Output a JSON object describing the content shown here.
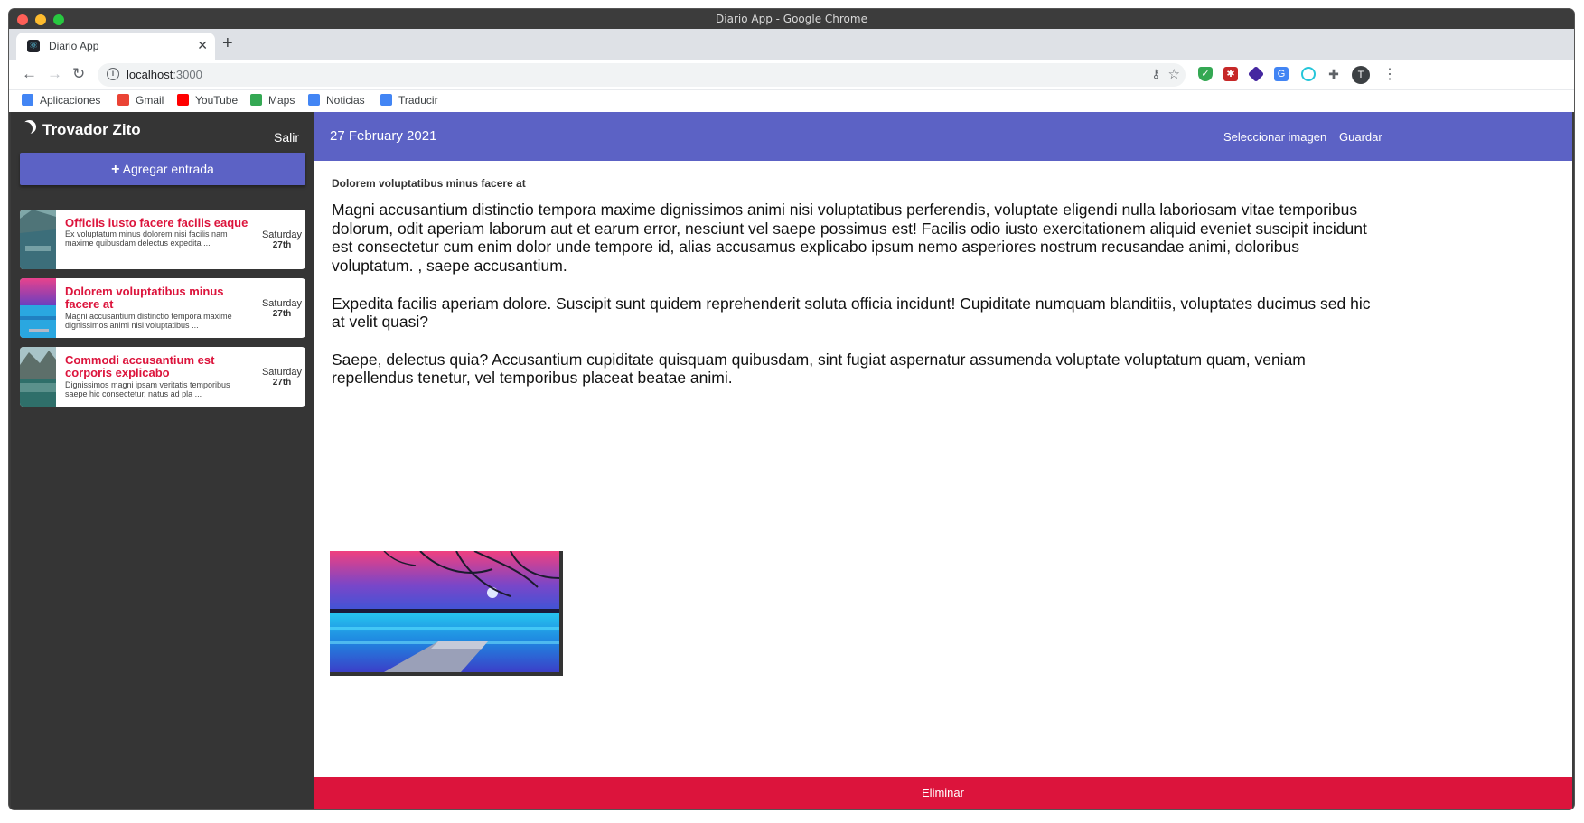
{
  "window": {
    "title": "Diario App - Google Chrome"
  },
  "browser": {
    "tab_title": "Diario App",
    "tab_close": "✕",
    "new_tab": "+",
    "url_host": "localhost",
    "url_port": ":3000",
    "bookmarks": [
      {
        "label": "Aplicaciones",
        "icon": "apps-grid-icon",
        "color": "#4285f4"
      },
      {
        "label": "Gmail",
        "icon": "gmail-icon",
        "color": "#ea4335"
      },
      {
        "label": "YouTube",
        "icon": "youtube-icon",
        "color": "#ff0000"
      },
      {
        "label": "Maps",
        "icon": "maps-icon",
        "color": "#34a853"
      },
      {
        "label": "Noticias",
        "icon": "news-icon",
        "color": "#4285f4"
      },
      {
        "label": "Traducir",
        "icon": "translate-icon",
        "color": "#4285f4"
      }
    ],
    "avatar_letter": "T"
  },
  "sidebar": {
    "user_name": "Trovador Zito",
    "logout_label": "Salir",
    "new_entry_label": "Agregar entrada",
    "entries": [
      {
        "title": "Officiis iusto facere facilis eaque",
        "body": "Ex voluptatum minus dolorem nisi facilis nam maxime quibusdam delectus expedita ...",
        "day": "Saturday",
        "date": "27th"
      },
      {
        "title": "Dolorem voluptatibus minus facere at",
        "body": "Magni accusantium distinctio tempora maxime dignissimos animi nisi voluptatibus ...",
        "day": "Saturday",
        "date": "27th"
      },
      {
        "title": "Commodi accusantium est corporis explicabo",
        "body": "Dignissimos magni ipsam veritatis temporibus saepe hic consectetur, natus ad pla ...",
        "day": "Saturday",
        "date": "27th"
      }
    ]
  },
  "main": {
    "date": "27 February 2021",
    "select_image_label": "Seleccionar imagen",
    "save_label": "Guardar",
    "entry_title": "Dolorem voluptatibus minus facere at",
    "paragraphs": [
      "Magni accusantium distinctio tempora maxime dignissimos animi nisi voluptatibus perferendis, voluptate eligendi nulla laboriosam vitae temporibus dolorum, odit aperiam laborum aut et earum error, nesciunt vel saepe possimus est! Facilis odio iusto exercitationem aliquid eveniet suscipit incidunt est consectetur cum enim dolor unde tempore id, alias accusamus explicabo ipsum nemo asperiores nostrum recusandae animi, doloribus voluptatum. , saepe accusantium.",
      "Expedita facilis aperiam dolore. Suscipit sunt quidem reprehenderit soluta officia incidunt! Cupiditate numquam blanditiis, voluptates ducimus sed hic at velit quasi?",
      "Saepe, delectus quia? Accusantium cupiditate quisquam quibusdam, sint fugiat aspernatur assumenda voluptate voluptatum quam, veniam repellendus tenetur, vel temporibus placeat beatae animi."
    ],
    "delete_label": "Eliminar"
  },
  "colors": {
    "accent": "#5c62c5",
    "danger": "#dc143c",
    "sidebar_bg": "#353535"
  }
}
